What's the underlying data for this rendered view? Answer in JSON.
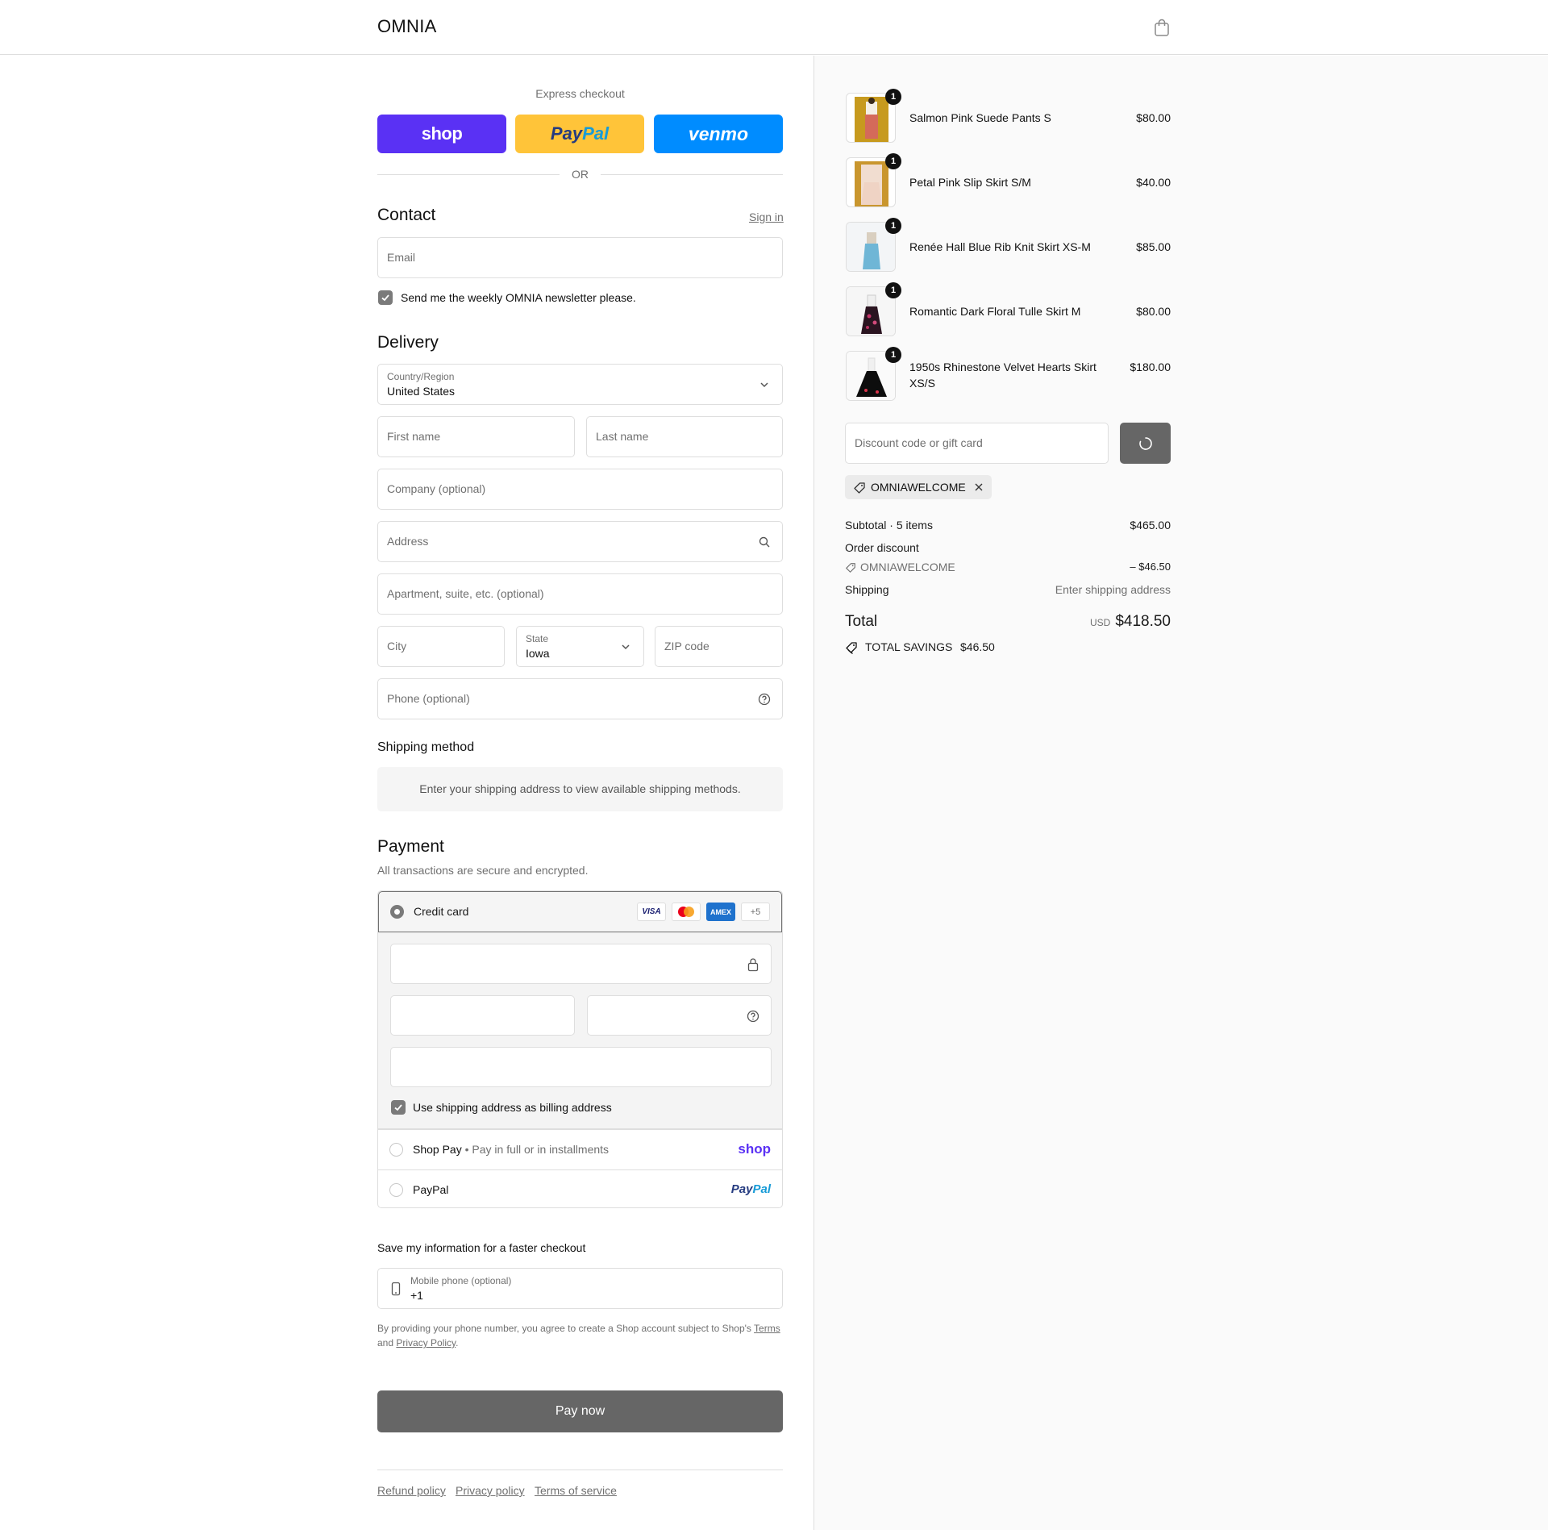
{
  "header": {
    "brand": "OMNIA",
    "cart_icon": "shopping-bag-icon"
  },
  "express": {
    "title": "Express checkout",
    "shop_label": "shop",
    "paypal_label_1": "Pay",
    "paypal_label_2": "Pal",
    "venmo_label": "venmo",
    "or_label": "OR"
  },
  "contact": {
    "title": "Contact",
    "sign_in": "Sign in",
    "email_placeholder": "Email",
    "newsletter_label": "Send me the weekly OMNIA newsletter please.",
    "newsletter_checked": true
  },
  "delivery": {
    "title": "Delivery",
    "country_label": "Country/Region",
    "country_value": "United States",
    "first_name_placeholder": "First name",
    "last_name_placeholder": "Last name",
    "company_placeholder": "Company (optional)",
    "address_placeholder": "Address",
    "apartment_placeholder": "Apartment, suite, etc. (optional)",
    "city_placeholder": "City",
    "state_label": "State",
    "state_value": "Iowa",
    "zip_placeholder": "ZIP code",
    "phone_placeholder": "Phone (optional)"
  },
  "shipping_method": {
    "title": "Shipping method",
    "message": "Enter your shipping address to view available shipping methods."
  },
  "payment": {
    "title": "Payment",
    "subtitle": "All transactions are secure and encrypted.",
    "credit_card_label": "Credit card",
    "card_logos": [
      "VISA",
      "AMEX"
    ],
    "more_cards": "+5",
    "billing_same_label": "Use shipping address as billing address",
    "billing_same_checked": true,
    "shop_pay_label": "Shop Pay",
    "shop_pay_sub": "Pay in full or in installments",
    "shop_pay_logo": "shop",
    "paypal_label": "PayPal",
    "paypal_logo_1": "Pay",
    "paypal_logo_2": "Pal"
  },
  "save_info": {
    "title": "Save my information for a faster checkout",
    "mobile_label": "Mobile phone (optional)",
    "mobile_value": "+1",
    "legal_1": "By providing your phone number, you agree to create a Shop account subject to Shop's",
    "terms": "Terms",
    "legal_and": "and",
    "privacy": "Privacy Policy",
    "legal_end": "."
  },
  "pay_now": "Pay now",
  "footer_links": [
    "Refund policy",
    "Privacy policy",
    "Terms of service"
  ],
  "summary": {
    "items": [
      {
        "name": "Salmon Pink Suede Pants S",
        "price": "$80.00",
        "qty": "1"
      },
      {
        "name": "Petal Pink Slip Skirt S/M",
        "price": "$40.00",
        "qty": "1"
      },
      {
        "name": "Renée Hall Blue Rib Knit Skirt XS-M",
        "price": "$85.00",
        "qty": "1"
      },
      {
        "name": "Romantic Dark Floral Tulle Skirt M",
        "price": "$80.00",
        "qty": "1"
      },
      {
        "name": "1950s Rhinestone Velvet Hearts Skirt XS/S",
        "price": "$180.00",
        "qty": "1"
      }
    ],
    "discount_placeholder": "Discount code or gift card",
    "applied_code": "OMNIAWELCOME",
    "subtotal_label": "Subtotal · 5 items",
    "subtotal_value": "$465.00",
    "order_discount_label": "Order discount",
    "discount_code": "OMNIAWELCOME",
    "discount_value": "– $46.50",
    "shipping_label": "Shipping",
    "shipping_value": "Enter shipping address",
    "total_label": "Total",
    "currency": "USD",
    "total_value": "$418.50",
    "savings_label": "TOTAL SAVINGS",
    "savings_value": "$46.50"
  }
}
